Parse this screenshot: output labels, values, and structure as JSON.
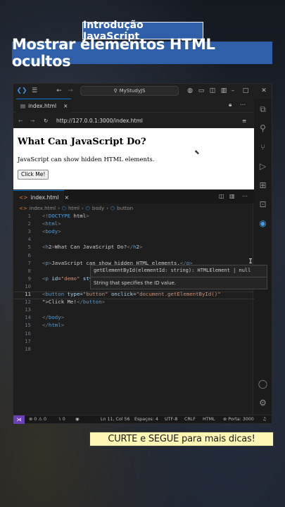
{
  "top_badge": "Introdução JavaScript",
  "main_title": "Mostrar elementos HTML ocultos",
  "window": {
    "search": "MyStudyJS",
    "browser_tab": "index.html",
    "url": "http://127.0.0.1:3000/index.html",
    "page": {
      "heading": "What Can JavaScript Do?",
      "paragraph": "JavaScript can show hidden HTML elements.",
      "button": "Click Me!"
    },
    "editor_tab": "index.html",
    "breadcrumb": [
      "index.html",
      "html",
      "body",
      "button"
    ],
    "code": [
      "<!DOCTYPE html>",
      "<html>",
      "<body>",
      "",
      "<h2>What Can JavaScript Do?</h2>",
      "",
      "<p>JavaScript can show hidden HTML elements.</p>",
      "",
      "<p id=\"demo\" style=\"display:none\">Hello JavaScript!</p>",
      "",
      "<button type=\"button\" onclick=\"document.getElementById()",
      "\">Click Me!</button>",
      "",
      "</body>",
      "</html>",
      "",
      "",
      ""
    ],
    "line_numbers": [
      "1",
      "2",
      "3",
      "4",
      "5",
      "6",
      "7",
      "8",
      "9",
      "10",
      "11",
      "12",
      "13",
      "14",
      "15",
      "16",
      "17",
      "18"
    ],
    "tooltip": {
      "signature": "getElementById(elementId: string): HTMLElement | null",
      "description": "String that specifies the ID value."
    },
    "status": {
      "errors": "0",
      "warnings": "0",
      "ports": "0",
      "position": "Ln 11, Col 56",
      "spaces": "Espaços: 4",
      "encoding": "UTF-8",
      "eol": "CRLF",
      "language": "HTML",
      "port": "Porta: 3000"
    }
  },
  "cta": "CURTE e SEGUE para mais dicas!"
}
